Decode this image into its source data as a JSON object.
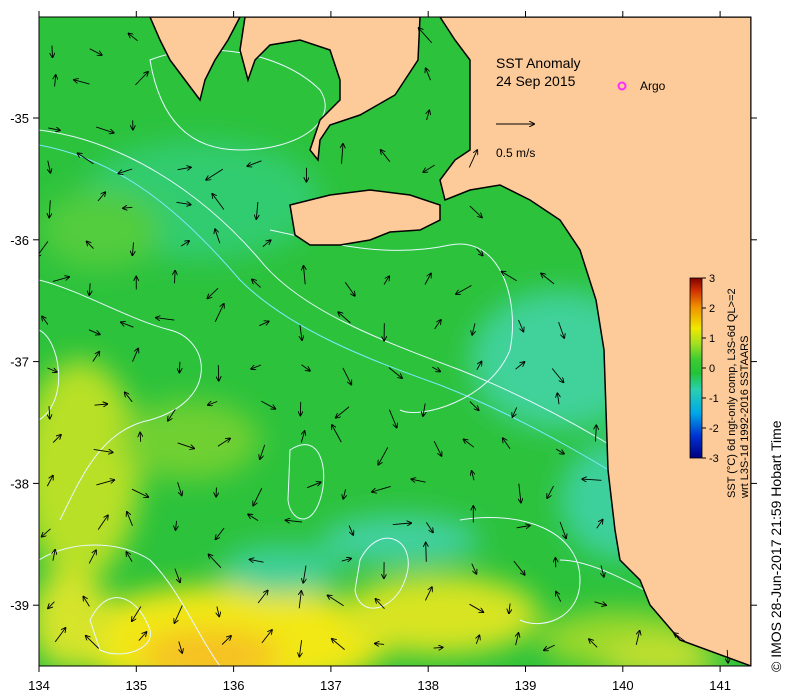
{
  "title": {
    "line1": "SST Anomaly",
    "line2": "24 Sep 2015"
  },
  "legend": {
    "argo_label": "Argo",
    "argo_color": "#ff2bff",
    "vector_label": "0.5 m/s"
  },
  "axes": {
    "x_ticks": [
      "134",
      "135",
      "136",
      "137",
      "138",
      "139",
      "140",
      "141"
    ],
    "y_ticks": [
      "-35",
      "-36",
      "-37",
      "-38",
      "-39"
    ]
  },
  "colorbar": {
    "ticks": [
      "3",
      "2",
      "1",
      "0",
      "-1",
      "-2",
      "-3"
    ],
    "label_line1": "SST (°C) 6d ngt-only comp, L3S-6d QL>=2",
    "label_line2": "wrt L3S-1d 1992-2016 SSTAARS",
    "colors": [
      "#00007f",
      "#0030d0",
      "#00a8e8",
      "#2ad0b0",
      "#22c43a",
      "#3fcc30",
      "#a8e020",
      "#f0e800",
      "#f09000",
      "#d03000",
      "#800000"
    ]
  },
  "credit": "© IMOS 28-Jun-2017 21:59 Hobart Time",
  "colors": {
    "land": "#fdcb9a",
    "ocean_base": "#2cc23c",
    "cold_anomaly": "#45d49a",
    "warm_anomaly": "#e8e82a"
  }
}
